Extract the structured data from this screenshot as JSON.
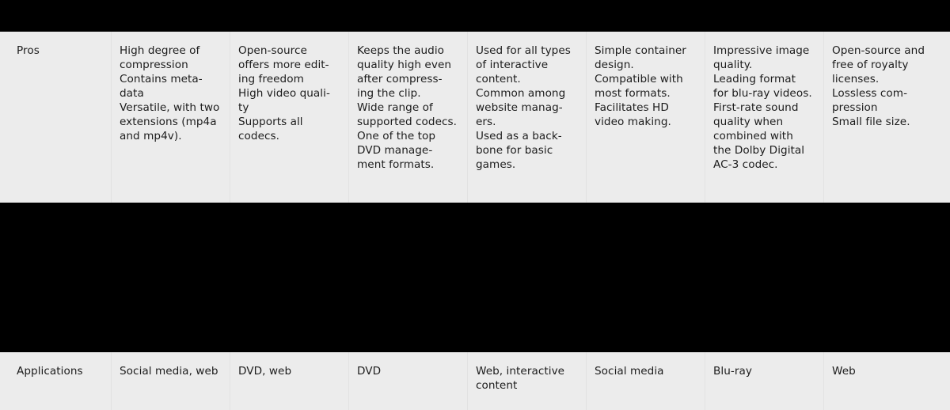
{
  "table": {
    "column_count": 8,
    "colors": {
      "row_background": "#ececec",
      "occluder": "#000000",
      "text": "#1c1c1c",
      "divider": "#e2e2e2"
    },
    "rows": [
      {
        "id": "pros",
        "label": "Pros",
        "cells": [
          "High degree of compression\nContains meta-\ndata\nVersatile, with two extensions (mp4a and mp4v).",
          "Open-source offers more edit-\ning freedom\nHigh video quali-\nty\nSupports all codecs.",
          "Keeps the audio quality high even after compress-\ning the clip.\nWide range of supported codecs.\nOne of the top DVD manage-\nment formats.",
          "Used for all types of interactive content.\nCommon among website manag-\ners.\nUsed as a back-\nbone for basic games.",
          "Simple container design.\nCompatible with most formats.\nFacilitates HD video making.",
          "Impressive image quality.\nLeading format for blu-ray videos.\nFirst-rate sound quality when combined with the Dolby Digital AC-3 codec.",
          "Open-source and free of royalty licenses.\nLossless com-\npression\nSmall file size."
        ]
      },
      {
        "id": "applications",
        "label": "Applications",
        "cells": [
          "Social media, web",
          "DVD, web",
          "DVD",
          "Web, interactive content",
          "Social media",
          "Blu-ray",
          "Web"
        ]
      }
    ]
  }
}
